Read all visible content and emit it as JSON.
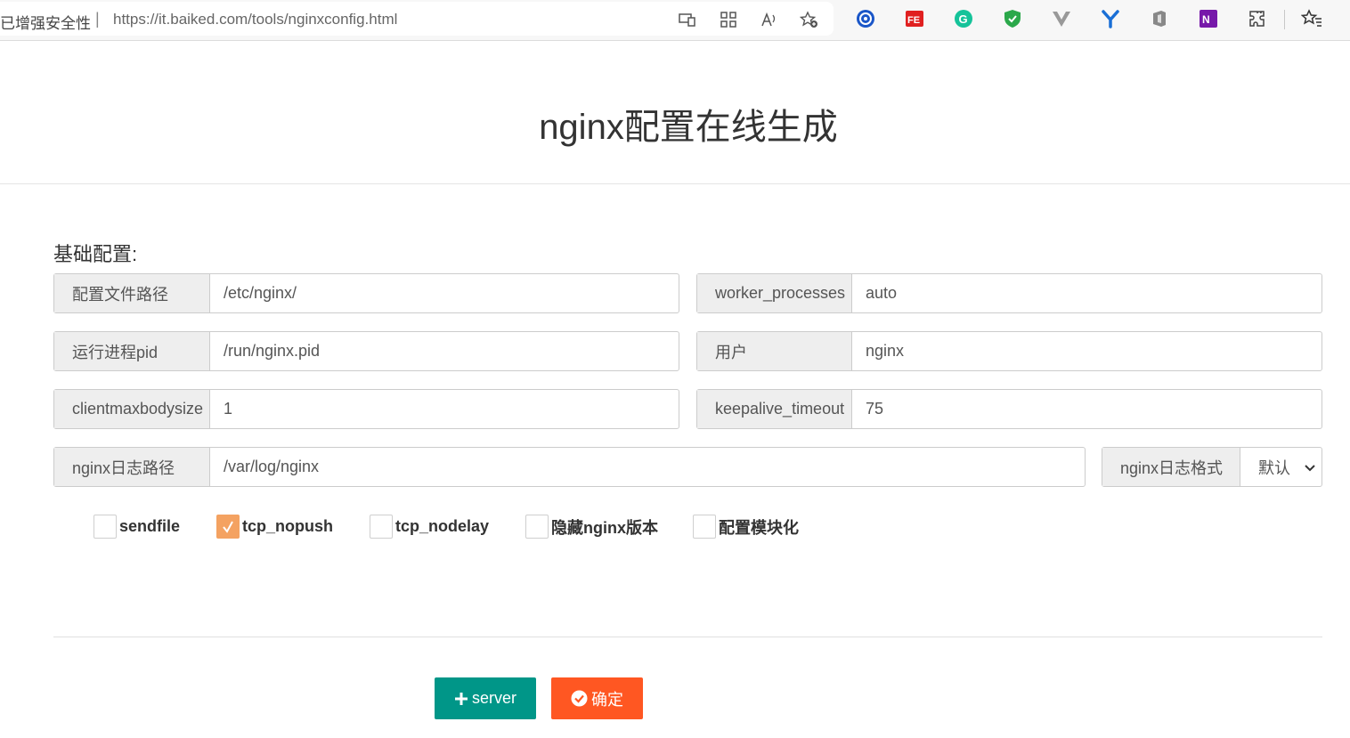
{
  "browser": {
    "security_text": "已增强安全性",
    "separator": "|",
    "url": "https://it.baiked.com/tools/nginxconfig.html"
  },
  "page": {
    "title": "nginx配置在线生成",
    "section_label": "基础配置:"
  },
  "fields": {
    "config_path": {
      "label": "配置文件路径",
      "value": "/etc/nginx/"
    },
    "worker_processes": {
      "label": "worker_processes",
      "value": "auto"
    },
    "pid": {
      "label": "运行进程pid",
      "value": "/run/nginx.pid"
    },
    "user": {
      "label": "用户",
      "value": "nginx"
    },
    "clientmaxbodysize": {
      "label": "clientmaxbodysize",
      "value": "1"
    },
    "keepalive_timeout": {
      "label": "keepalive_timeout",
      "value": "75"
    },
    "log_path": {
      "label": "nginx日志路径",
      "value": "/var/log/nginx"
    },
    "log_format": {
      "label": "nginx日志格式",
      "selected": "默认"
    }
  },
  "checkboxes": [
    {
      "label": "sendfile",
      "checked": false
    },
    {
      "label": "tcp_nopush",
      "checked": true
    },
    {
      "label": "tcp_nodelay",
      "checked": false
    },
    {
      "label": "隐藏nginx版本",
      "checked": false
    },
    {
      "label": "配置模块化",
      "checked": false
    }
  ],
  "buttons": {
    "add_server": "server",
    "confirm": "确定"
  },
  "colors": {
    "primary_green": "#009688",
    "confirm_orange": "#ff5722",
    "checkbox_checked": "#f4a261"
  }
}
